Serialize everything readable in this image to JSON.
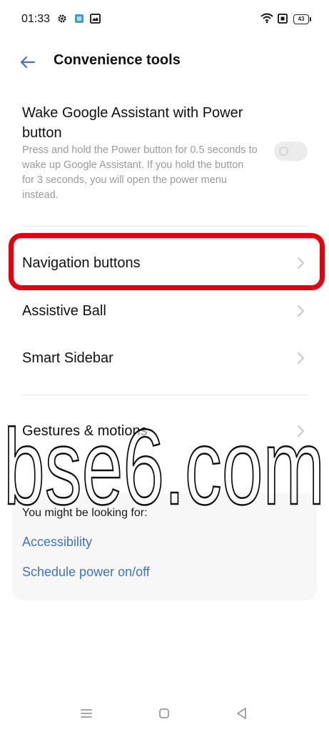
{
  "status_bar": {
    "time": "01:33",
    "battery": "43",
    "icons": [
      "gear-icon",
      "app-icon",
      "gallery-icon",
      "wifi-icon",
      "sim-icon",
      "battery-icon"
    ]
  },
  "header": {
    "title": "Convenience tools",
    "back_icon": "arrow-left-icon"
  },
  "wake_assistant": {
    "title": "Wake Google Assistant with Power button",
    "description": "Press and hold the Power button for 0.5 seconds to wake up Google Assistant. If you hold the button for 3 seconds, you will open the power menu instead.",
    "enabled": false
  },
  "menu": {
    "navigation": "Navigation buttons",
    "assistive_ball": "Assistive Ball",
    "smart_sidebar": "Smart Sidebar",
    "gestures": "Gestures & motions"
  },
  "suggestions": {
    "heading": "You might be looking for:",
    "links": [
      "Accessibility",
      "Schedule power on/off"
    ]
  },
  "watermark": "bse6.com",
  "colors": {
    "accent": "#3f73c8",
    "highlight": "#e3000f",
    "secondary_text": "#9a9a9a"
  },
  "nav_bar": {
    "icons": [
      "menu-icon",
      "home-icon",
      "back-icon"
    ]
  }
}
